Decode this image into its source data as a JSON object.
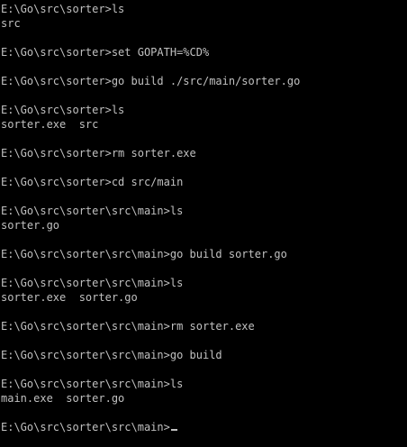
{
  "console": {
    "lines": [
      "E:\\Go\\src\\sorter>ls",
      "src",
      "",
      "E:\\Go\\src\\sorter>set GOPATH=%CD%",
      "",
      "E:\\Go\\src\\sorter>go build ./src/main/sorter.go",
      "",
      "E:\\Go\\src\\sorter>ls",
      "sorter.exe  src",
      "",
      "E:\\Go\\src\\sorter>rm sorter.exe",
      "",
      "E:\\Go\\src\\sorter>cd src/main",
      "",
      "E:\\Go\\src\\sorter\\src\\main>ls",
      "sorter.go",
      "",
      "E:\\Go\\src\\sorter\\src\\main>go build sorter.go",
      "",
      "E:\\Go\\src\\sorter\\src\\main>ls",
      "sorter.exe  sorter.go",
      "",
      "E:\\Go\\src\\sorter\\src\\main>rm sorter.exe",
      "",
      "E:\\Go\\src\\sorter\\src\\main>go build",
      "",
      "E:\\Go\\src\\sorter\\src\\main>ls",
      "main.exe  sorter.go",
      "",
      "E:\\Go\\src\\sorter\\src\\main>"
    ]
  }
}
